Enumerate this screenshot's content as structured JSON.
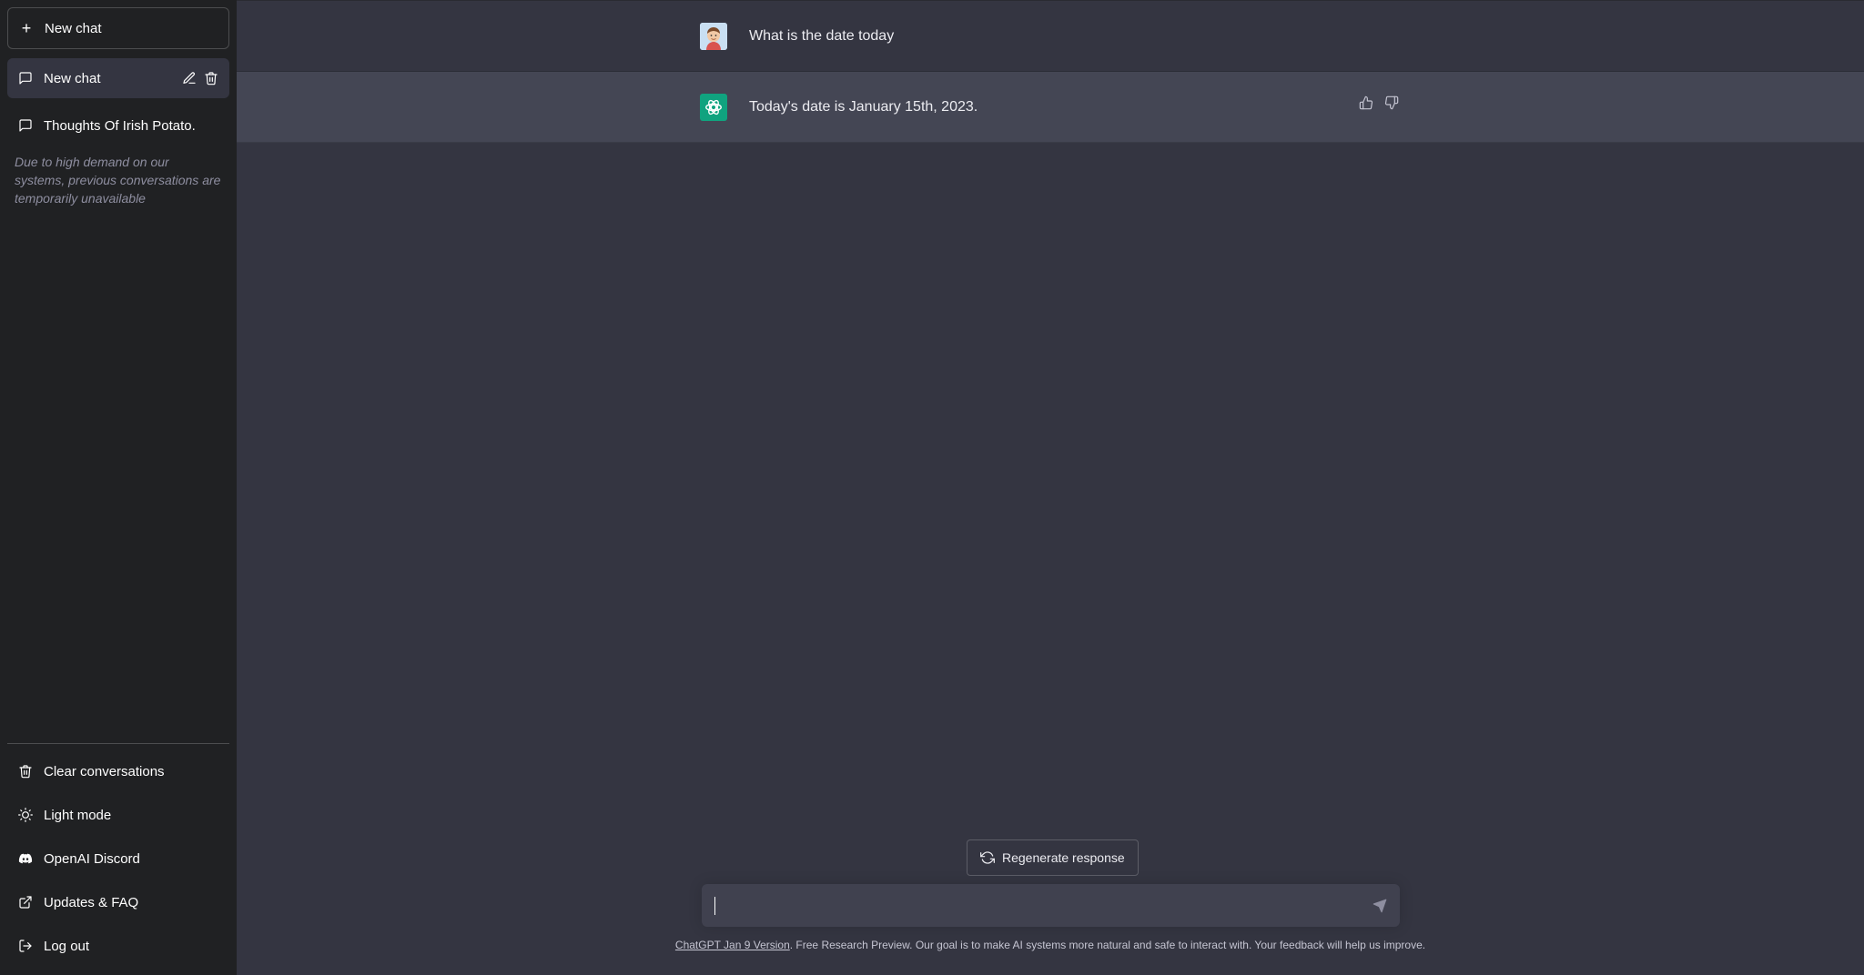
{
  "sidebar": {
    "new_chat_label": "New chat",
    "conversations": [
      {
        "label": "New chat",
        "active": true
      },
      {
        "label": "Thoughts Of Irish Potato.",
        "active": false
      }
    ],
    "notice": "Due to high demand on our systems, previous conversations are temporarily unavailable",
    "bottom_items": [
      {
        "label": "Clear conversations",
        "icon": "trash-icon"
      },
      {
        "label": "Light mode",
        "icon": "sun-icon"
      },
      {
        "label": "OpenAI Discord",
        "icon": "discord-icon"
      },
      {
        "label": "Updates & FAQ",
        "icon": "external-link-icon"
      },
      {
        "label": "Log out",
        "icon": "logout-icon"
      }
    ]
  },
  "messages": [
    {
      "role": "user",
      "text": "What is the date today"
    },
    {
      "role": "assistant",
      "text": "Today's date is January 15th, 2023."
    }
  ],
  "regenerate_label": "Regenerate response",
  "input": {
    "value": "",
    "placeholder": ""
  },
  "footer": {
    "version_link": "ChatGPT Jan 9 Version",
    "text": ". Free Research Preview. Our goal is to make AI systems more natural and safe to interact with. Your feedback will help us improve."
  },
  "colors": {
    "sidebar_bg": "#202123",
    "main_bg": "#343541",
    "assistant_row_bg": "#444654",
    "brand_green": "#10a37f"
  }
}
